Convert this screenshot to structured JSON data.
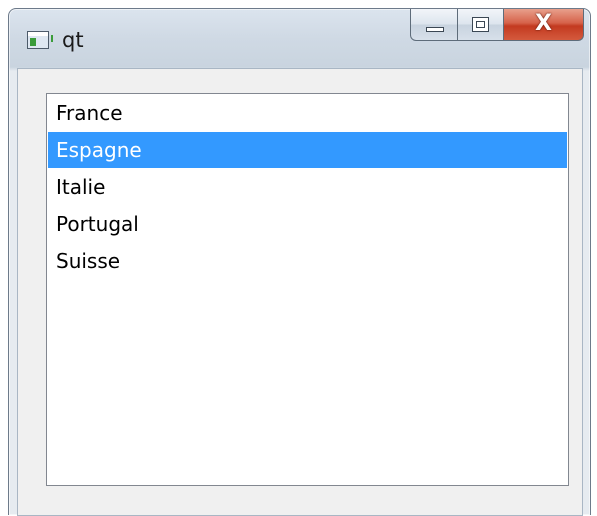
{
  "window": {
    "title": "qt",
    "app_icon": "qt-app-icon",
    "caption_buttons": {
      "minimize_icon": "minimize-icon",
      "maximize_icon": "maximize-icon",
      "close_glyph": "X"
    }
  },
  "list": {
    "items": [
      {
        "label": "France",
        "selected": false
      },
      {
        "label": "Espagne",
        "selected": true
      },
      {
        "label": "Italie",
        "selected": false
      },
      {
        "label": "Portugal",
        "selected": false
      },
      {
        "label": "Suisse",
        "selected": false
      }
    ],
    "selection_color": "#3399ff"
  },
  "colors": {
    "close_button": "#c9452b",
    "selection": "#3399ff"
  }
}
